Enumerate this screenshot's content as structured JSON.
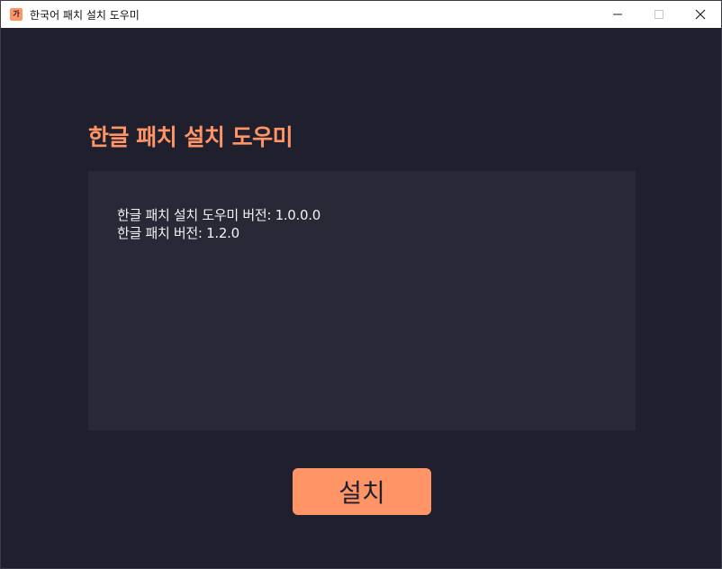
{
  "window": {
    "title": "한국어 패치 설치 도우미",
    "app_icon_glyph": "가",
    "controls": {
      "minimize_icon": "minimize-icon",
      "maximize_icon": "maximize-icon",
      "close_icon": "close-icon"
    }
  },
  "main": {
    "heading": "한글 패치 설치 도우미",
    "info": {
      "helper_version": "한글 패치 설치 도우미 버전: 1.0.0.0",
      "patch_version": "한글 패치 버전: 1.2.0"
    },
    "install_button_label": "설치"
  },
  "colors": {
    "accent": "#ff9466",
    "background": "#1f1f2e",
    "panel": "#282837",
    "text": "#f2f2f2"
  }
}
